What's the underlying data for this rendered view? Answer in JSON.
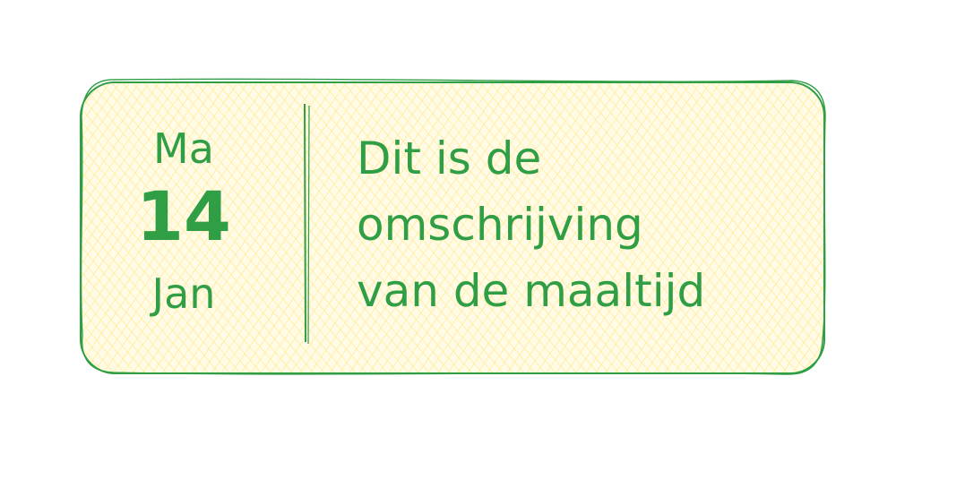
{
  "card": {
    "weekday": "Ma",
    "day": "14",
    "month": "Jan",
    "description_lines": [
      "Dit is de",
      "omschrijving",
      "van de maaltijd"
    ]
  },
  "colors": {
    "stroke": "#2f9e44",
    "fill": "#ffec99",
    "background": "#ffffff"
  }
}
